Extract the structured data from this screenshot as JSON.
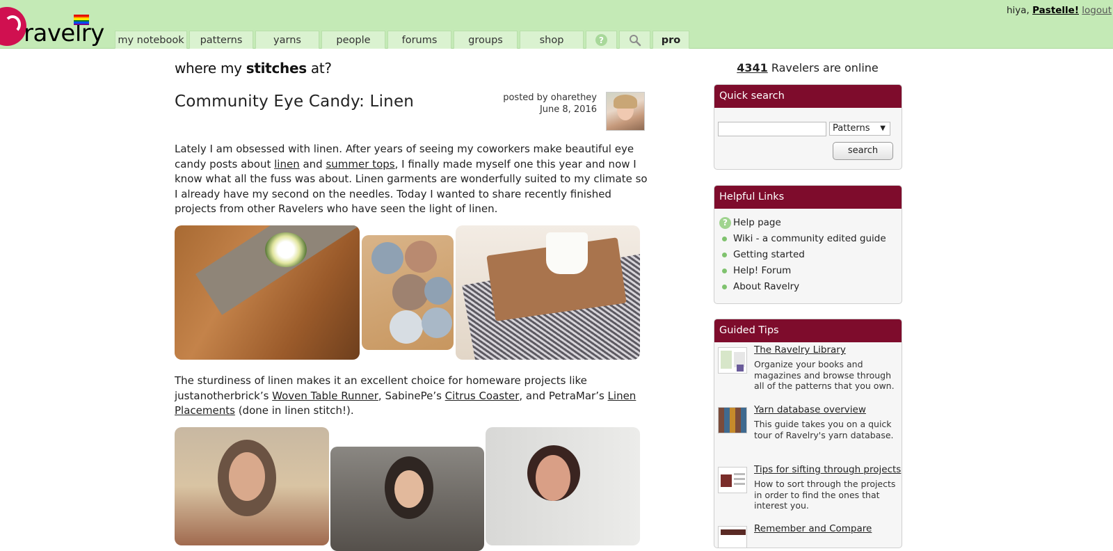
{
  "header": {
    "logo_text": "ravelry",
    "greeting": "hiya,",
    "username": "Pastelle!",
    "logout": "logout",
    "nav": [
      {
        "label": "my notebook"
      },
      {
        "label": "patterns"
      },
      {
        "label": "yarns"
      },
      {
        "label": "people"
      },
      {
        "label": "forums"
      },
      {
        "label": "groups"
      },
      {
        "label": "shop"
      },
      {
        "label": "?"
      },
      {
        "label": "pro"
      }
    ]
  },
  "post": {
    "blog_title_pre": "where my ",
    "blog_title_bold": "stitches",
    "blog_title_post": " at?",
    "title": "Community Eye Candy: Linen",
    "posted_by": "posted by oharethey",
    "date": "June 8, 2016",
    "p1": [
      "Lately I am obsessed with linen. After years of seeing my coworkers make beautiful eye candy posts about ",
      "linen",
      " and ",
      "summer tops",
      ", I finally made myself one this year and now I know what all the fuss was about. Linen garments are wonderfully suited to my climate so I already have my second on the needles. Today I wanted to share recently finished projects from other Ravelers who have seen the light of linen."
    ],
    "p2": [
      "The sturdiness of linen makes it an excellent choice for homeware projects like justanotherbrick’s ",
      "Woven Table Runner",
      ", SabinePe’s ",
      "Citrus Coaster",
      ", and PetraMar’s ",
      "Linen Placements",
      " (done in linen stitch!)."
    ]
  },
  "sidebar": {
    "online_count": "4341",
    "online_text": " Ravelers are online",
    "quick_search": {
      "title": "Quick search",
      "input_value": "",
      "select_value": "Patterns",
      "button": "search"
    },
    "helpful_links": {
      "title": "Helpful Links",
      "items": [
        "Help page",
        "Wiki - a community edited guide",
        "Getting started",
        "Help! Forum",
        "About Ravelry"
      ]
    },
    "guided_tips": {
      "title": "Guided Tips",
      "items": [
        {
          "title": "The Ravelry Library",
          "desc": "Organize your books and magazines and browse through all of the patterns that you own."
        },
        {
          "title": "Yarn database overview",
          "desc": "This guide takes you on a quick tour of Ravelry's yarn database."
        },
        {
          "title": "Tips for sifting through projects",
          "desc": "How to sort through the projects in order to find the ones that interest you."
        },
        {
          "title": "Remember and Compare",
          "desc": ""
        }
      ]
    }
  },
  "colors": {
    "header_green": "#c4eab6",
    "box_header": "#7e0c2c",
    "logo_pink": "#d01050"
  }
}
